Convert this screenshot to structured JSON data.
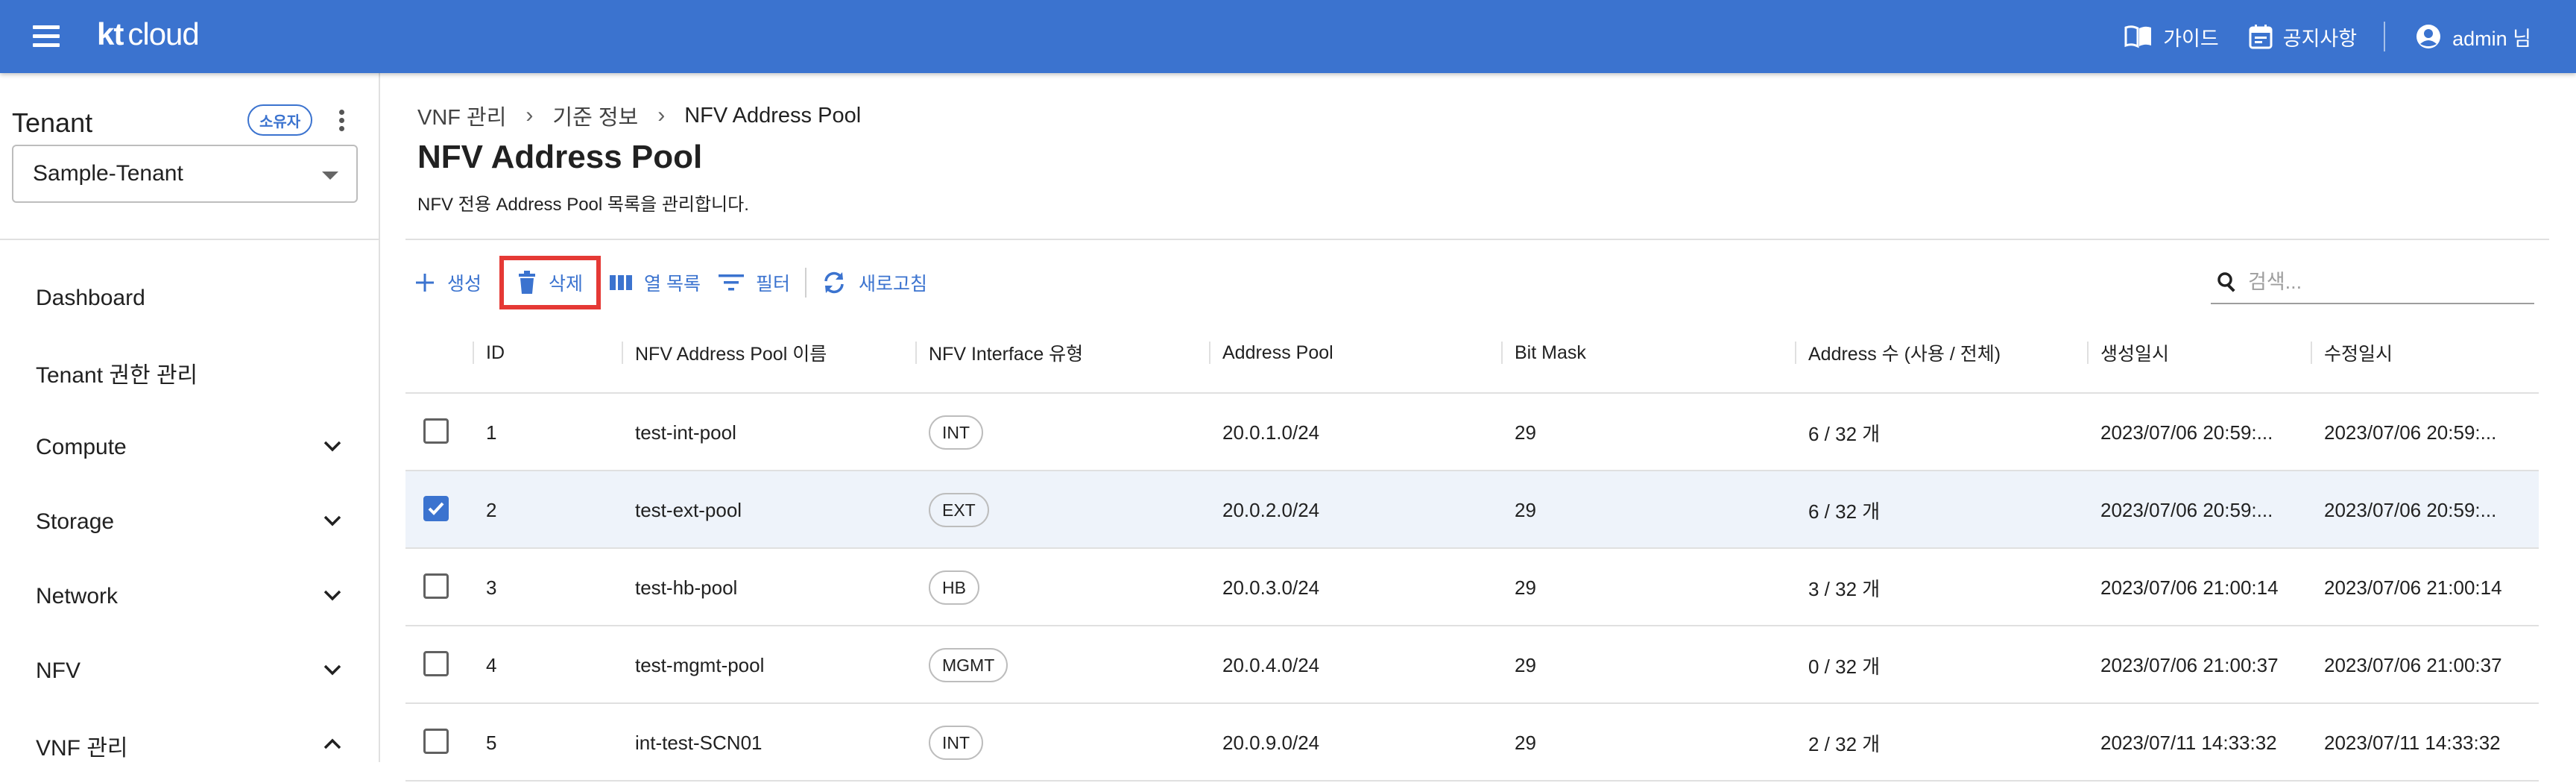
{
  "app": {
    "logo_kt": "kt",
    "logo_cloud": "cloud"
  },
  "topnav": {
    "guide": "가이드",
    "notice": "공지사항",
    "user": "admin 님"
  },
  "sidebar": {
    "tenant_title": "Tenant",
    "owner_badge": "소유자",
    "tenant_selected": "Sample-Tenant",
    "items": [
      {
        "label": "Dashboard",
        "expand": "none"
      },
      {
        "label": "Tenant 권한 관리",
        "expand": "none"
      },
      {
        "label": "Compute",
        "expand": "down"
      },
      {
        "label": "Storage",
        "expand": "down"
      },
      {
        "label": "Network",
        "expand": "down"
      },
      {
        "label": "NFV",
        "expand": "down"
      },
      {
        "label": "VNF 관리",
        "expand": "up"
      }
    ]
  },
  "breadcrumb": [
    "VNF 관리",
    "기준 정보",
    "NFV Address Pool"
  ],
  "page": {
    "title": "NFV Address Pool",
    "description": "NFV 전용 Address Pool 목록을 관리합니다."
  },
  "toolbar": {
    "create": "생성",
    "delete": "삭제",
    "columns": "열 목록",
    "filter": "필터",
    "refresh": "새로고침",
    "search_placeholder": "검색..."
  },
  "table": {
    "headers": {
      "id": "ID",
      "name": "NFV Address Pool 이름",
      "type": "NFV Interface 유형",
      "pool": "Address Pool",
      "mask": "Bit Mask",
      "addr": "Address 수 (사용 / 전체)",
      "created": "생성일시",
      "modified": "수정일시"
    },
    "rows": [
      {
        "checked": false,
        "id": "1",
        "name": "test-int-pool",
        "type": "INT",
        "pool": "20.0.1.0/24",
        "mask": "29",
        "addr": "6 / 32 개",
        "created": "2023/07/06 20:59:...",
        "modified": "2023/07/06 20:59:..."
      },
      {
        "checked": true,
        "id": "2",
        "name": "test-ext-pool",
        "type": "EXT",
        "pool": "20.0.2.0/24",
        "mask": "29",
        "addr": "6 / 32 개",
        "created": "2023/07/06 20:59:...",
        "modified": "2023/07/06 20:59:..."
      },
      {
        "checked": false,
        "id": "3",
        "name": "test-hb-pool",
        "type": "HB",
        "pool": "20.0.3.0/24",
        "mask": "29",
        "addr": "3 / 32 개",
        "created": "2023/07/06 21:00:14",
        "modified": "2023/07/06 21:00:14"
      },
      {
        "checked": false,
        "id": "4",
        "name": "test-mgmt-pool",
        "type": "MGMT",
        "pool": "20.0.4.0/24",
        "mask": "29",
        "addr": "0 / 32 개",
        "created": "2023/07/06 21:00:37",
        "modified": "2023/07/06 21:00:37"
      },
      {
        "checked": false,
        "id": "5",
        "name": "int-test-SCN01",
        "type": "INT",
        "pool": "20.0.9.0/24",
        "mask": "29",
        "addr": "2 / 32 개",
        "created": "2023/07/11 14:33:32",
        "modified": "2023/07/11 14:33:32"
      }
    ]
  },
  "colors": {
    "brand": "#3b73cf",
    "highlight": "#e53935",
    "selected_row": "#eef3fa"
  }
}
